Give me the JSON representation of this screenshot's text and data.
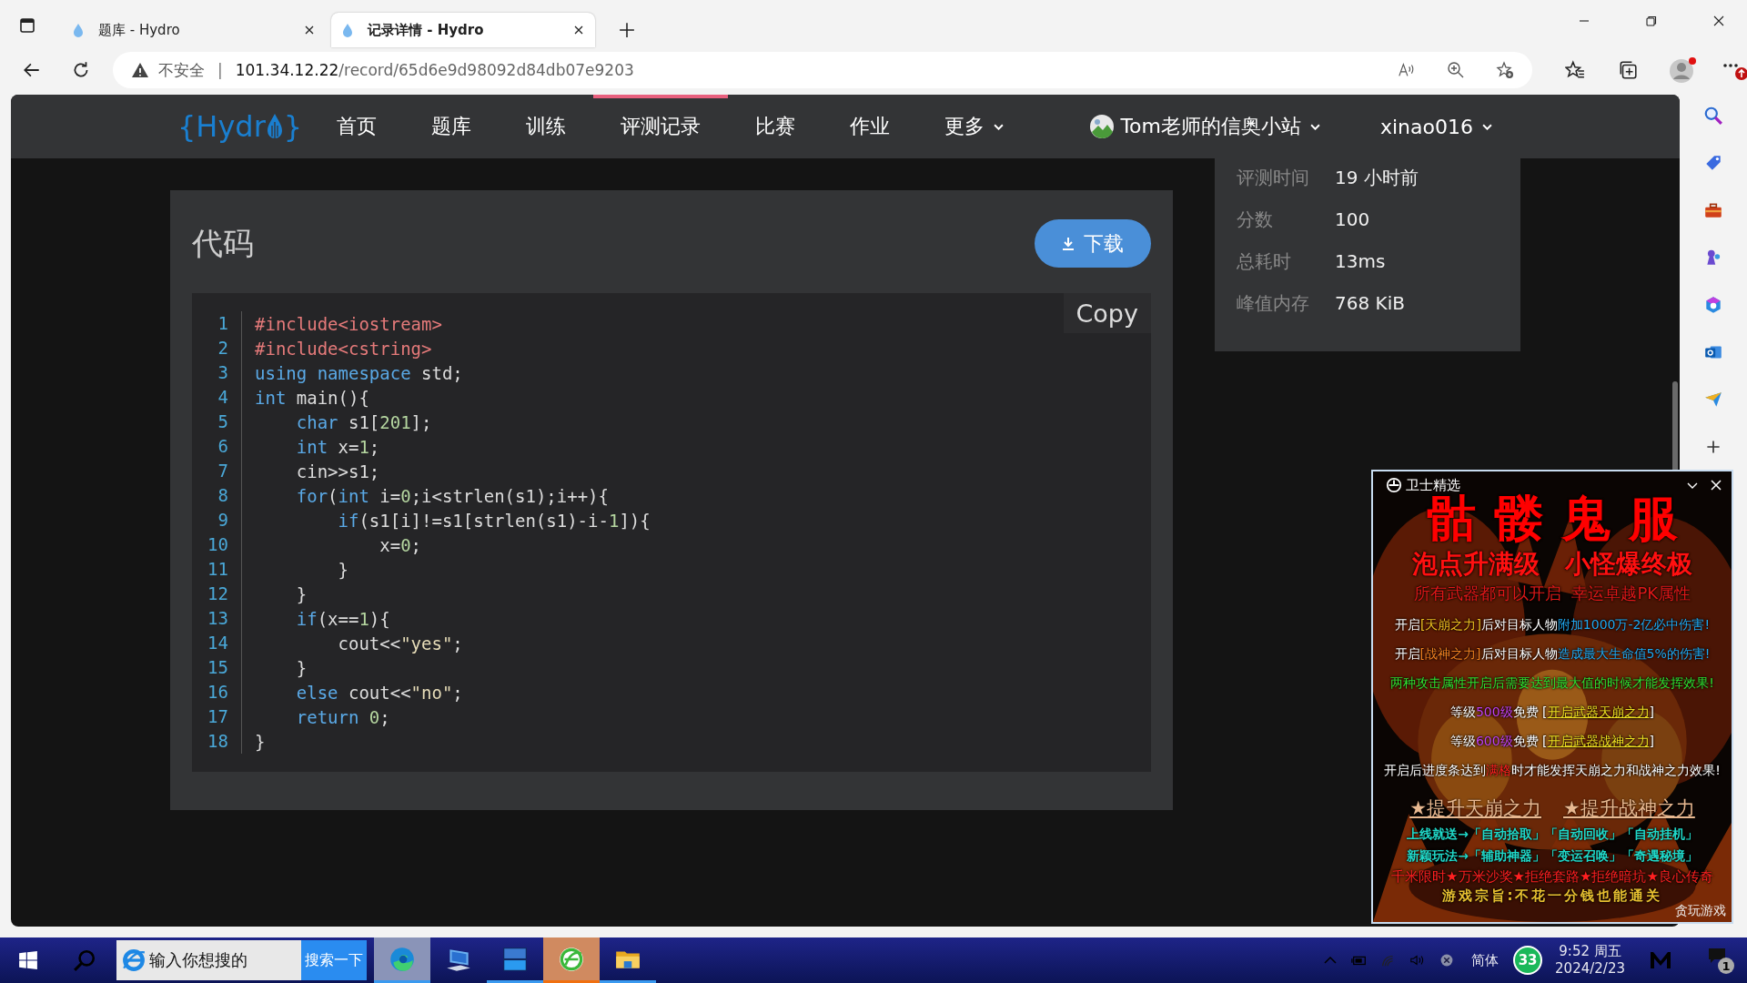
{
  "browser": {
    "tabs": [
      {
        "title": "题库 - Hydro",
        "selected": false
      },
      {
        "title": "记录详情 - Hydro",
        "selected": true
      }
    ],
    "address": {
      "security": "不安全",
      "separator": "|",
      "host": "101.34.12.22",
      "path": "/record/65d6e9d98092d84db07e9203"
    }
  },
  "site": {
    "logo": {
      "before": "{Hydr",
      "after": "}"
    },
    "nav": [
      {
        "label": "首页",
        "selected": false,
        "dropdown": false
      },
      {
        "label": "题库",
        "selected": false,
        "dropdown": false
      },
      {
        "label": "训练",
        "selected": false,
        "dropdown": false
      },
      {
        "label": "评测记录",
        "selected": true,
        "dropdown": false
      },
      {
        "label": "比赛",
        "selected": false,
        "dropdown": false
      },
      {
        "label": "作业",
        "selected": false,
        "dropdown": false
      },
      {
        "label": "更多",
        "selected": false,
        "dropdown": true
      }
    ],
    "site_menu": "Tom老师的信奥小站",
    "user_menu": "xinao016"
  },
  "code_card": {
    "title": "代码",
    "download": "下载",
    "copy": "Copy",
    "lines": [
      {
        "n": "1",
        "tokens": [
          {
            "kind": "pre",
            "text": "#include<iostream>"
          }
        ]
      },
      {
        "n": "2",
        "tokens": [
          {
            "kind": "pre",
            "text": "#include<cstring>"
          }
        ]
      },
      {
        "n": "3",
        "tokens": [
          {
            "kind": "kw",
            "text": "using namespace"
          },
          {
            "kind": "plain",
            "text": " std;"
          }
        ]
      },
      {
        "n": "4",
        "tokens": [
          {
            "kind": "kw",
            "text": "int"
          },
          {
            "kind": "plain",
            "text": " main(){"
          }
        ]
      },
      {
        "n": "5",
        "tokens": [
          {
            "kind": "kw",
            "text": "    char"
          },
          {
            "kind": "plain",
            "text": " s1["
          },
          {
            "kind": "num",
            "text": "201"
          },
          {
            "kind": "plain",
            "text": "];"
          }
        ]
      },
      {
        "n": "6",
        "tokens": [
          {
            "kind": "kw",
            "text": "    int"
          },
          {
            "kind": "plain",
            "text": " x="
          },
          {
            "kind": "num",
            "text": "1"
          },
          {
            "kind": "plain",
            "text": ";"
          }
        ]
      },
      {
        "n": "7",
        "tokens": [
          {
            "kind": "plain",
            "text": "    cin>>s1;"
          }
        ]
      },
      {
        "n": "8",
        "tokens": [
          {
            "kind": "kw",
            "text": "    for"
          },
          {
            "kind": "plain",
            "text": "("
          },
          {
            "kind": "kw",
            "text": "int"
          },
          {
            "kind": "plain",
            "text": " i="
          },
          {
            "kind": "num",
            "text": "0"
          },
          {
            "kind": "plain",
            "text": ";i<strlen(s1);i++){"
          }
        ]
      },
      {
        "n": "9",
        "tokens": [
          {
            "kind": "kw",
            "text": "        if"
          },
          {
            "kind": "plain",
            "text": "(s1[i]!=s1[strlen(s1)-i-"
          },
          {
            "kind": "num",
            "text": "1"
          },
          {
            "kind": "plain",
            "text": "]){"
          }
        ]
      },
      {
        "n": "10",
        "tokens": [
          {
            "kind": "plain",
            "text": "            x="
          },
          {
            "kind": "num",
            "text": "0"
          },
          {
            "kind": "plain",
            "text": ";"
          }
        ]
      },
      {
        "n": "11",
        "tokens": [
          {
            "kind": "plain",
            "text": "        }"
          }
        ]
      },
      {
        "n": "12",
        "tokens": [
          {
            "kind": "plain",
            "text": "    }"
          }
        ]
      },
      {
        "n": "13",
        "tokens": [
          {
            "kind": "kw",
            "text": "    if"
          },
          {
            "kind": "plain",
            "text": "(x=="
          },
          {
            "kind": "num",
            "text": "1"
          },
          {
            "kind": "plain",
            "text": "){"
          }
        ]
      },
      {
        "n": "14",
        "tokens": [
          {
            "kind": "plain",
            "text": "        cout<<"
          },
          {
            "kind": "str",
            "text": "\"yes\""
          },
          {
            "kind": "plain",
            "text": ";"
          }
        ]
      },
      {
        "n": "15",
        "tokens": [
          {
            "kind": "plain",
            "text": "    }"
          }
        ]
      },
      {
        "n": "16",
        "tokens": [
          {
            "kind": "kw",
            "text": "    else"
          },
          {
            "kind": "plain",
            "text": " cout<<"
          },
          {
            "kind": "str",
            "text": "\"no\""
          },
          {
            "kind": "plain",
            "text": ";"
          }
        ]
      },
      {
        "n": "17",
        "tokens": [
          {
            "kind": "kw",
            "text": "    return"
          },
          {
            "kind": "num",
            "text": " 0"
          },
          {
            "kind": "plain",
            "text": ";"
          }
        ]
      },
      {
        "n": "18",
        "tokens": [
          {
            "kind": "plain",
            "text": "}"
          }
        ]
      }
    ]
  },
  "info": [
    {
      "label": "评测时间",
      "value": "19 小时前"
    },
    {
      "label": "分数",
      "value": "100"
    },
    {
      "label": "总耗时",
      "value": "13ms"
    },
    {
      "label": "峰值内存",
      "value": "768 KiB"
    }
  ],
  "popup": {
    "title": "卫士精选",
    "lines": [
      {
        "kind": "title",
        "segments": [
          {
            "text": "骷髅鬼服",
            "color": "#ff0000"
          }
        ]
      },
      {
        "kind": "headline",
        "segments": [
          {
            "text": "泡点升满级　小怪爆终极",
            "color": "#ff1010"
          }
        ]
      },
      {
        "kind": "subtitle",
        "segments": [
          {
            "text": "所有武器都可以开启  幸运卓越PK属性",
            "color": "#e01818"
          }
        ]
      },
      {
        "kind": "text",
        "segments": [
          {
            "text": "开启",
            "color": "#ffffff"
          },
          {
            "text": "[天崩之力]",
            "color": "#f0c020"
          },
          {
            "text": "后对目标人物",
            "color": "#ffffff"
          },
          {
            "text": "附加1000万-2亿必中伤害!",
            "color": "#20a8f0"
          }
        ]
      },
      {
        "kind": "text",
        "segments": [
          {
            "text": "开启",
            "color": "#ffffff"
          },
          {
            "text": "[战神之力]",
            "color": "#f08020"
          },
          {
            "text": "后对目标人物",
            "color": "#ffffff"
          },
          {
            "text": "造成最大生命值5%的伤害!",
            "color": "#20a8f0"
          }
        ]
      },
      {
        "kind": "text",
        "segments": [
          {
            "text": "两种攻击属性开启后需要达到最大值的时候才能发挥效果!",
            "color": "#30e030"
          }
        ]
      },
      {
        "kind": "text",
        "segments": [
          {
            "text": "等级",
            "color": "#ffffff"
          },
          {
            "text": "500级",
            "color": "#c040f0"
          },
          {
            "text": "免费 [",
            "color": "#ffffff"
          },
          {
            "text": "开启武器天崩之力",
            "color": "#f0e020",
            "underline": true
          },
          {
            "text": "]",
            "color": "#ffffff"
          }
        ]
      },
      {
        "kind": "text",
        "segments": [
          {
            "text": "等级",
            "color": "#ffffff"
          },
          {
            "text": "600级",
            "color": "#c040f0"
          },
          {
            "text": "免费 [",
            "color": "#ffffff"
          },
          {
            "text": "开启武器战神之力",
            "color": "#f0e020",
            "underline": true
          },
          {
            "text": "]",
            "color": "#ffffff"
          }
        ]
      },
      {
        "kind": "text",
        "segments": [
          {
            "text": "开启后进度条达到",
            "color": "#ffffff"
          },
          {
            "text": "满格",
            "color": "#ff2020"
          },
          {
            "text": "时才能发挥天崩之力和战神之力效果!",
            "color": "#ffffff"
          }
        ]
      },
      {
        "kind": "links",
        "links": [
          "★提升天崩之力",
          "★提升战神之力"
        ]
      },
      {
        "kind": "promo",
        "segments": [
          {
            "text": "上线就送→「自动拾取」「自动回收」「自动挂机」",
            "color": "#20d8c8"
          }
        ]
      },
      {
        "kind": "promo",
        "segments": [
          {
            "text": "新颖玩法→「辅助神器」「变运召唤」「奇遇秘境」",
            "color": "#20d8c8"
          }
        ]
      },
      {
        "kind": "slogan",
        "segments": [
          {
            "text": "千米限时★万米沙奖★拒绝套路★拒绝暗坑★良心传奇",
            "color": "#ff2020"
          }
        ]
      },
      {
        "kind": "motto",
        "segments": [
          {
            "text": "游戏宗旨:不花一分钱也能通关",
            "color": "#e8c030"
          }
        ]
      }
    ],
    "brand": "贪玩游戏"
  },
  "taskbar": {
    "search_placeholder": "输入你想搜的",
    "search_button": "搜索一下",
    "apps": [
      {
        "kind": "edge",
        "running": true,
        "selected": true,
        "attention": false
      },
      {
        "kind": "computer",
        "running": false,
        "selected": false,
        "attention": false
      },
      {
        "kind": "devcpp",
        "running": true,
        "selected": false,
        "attention": false
      },
      {
        "kind": "browser360",
        "running": true,
        "selected": false,
        "attention": true
      },
      {
        "kind": "folder",
        "running": true,
        "selected": false,
        "attention": false
      }
    ],
    "ime": "简体",
    "badge": "33",
    "time": "9:52 周五",
    "date": "2024/2/23",
    "notifications": "1"
  }
}
